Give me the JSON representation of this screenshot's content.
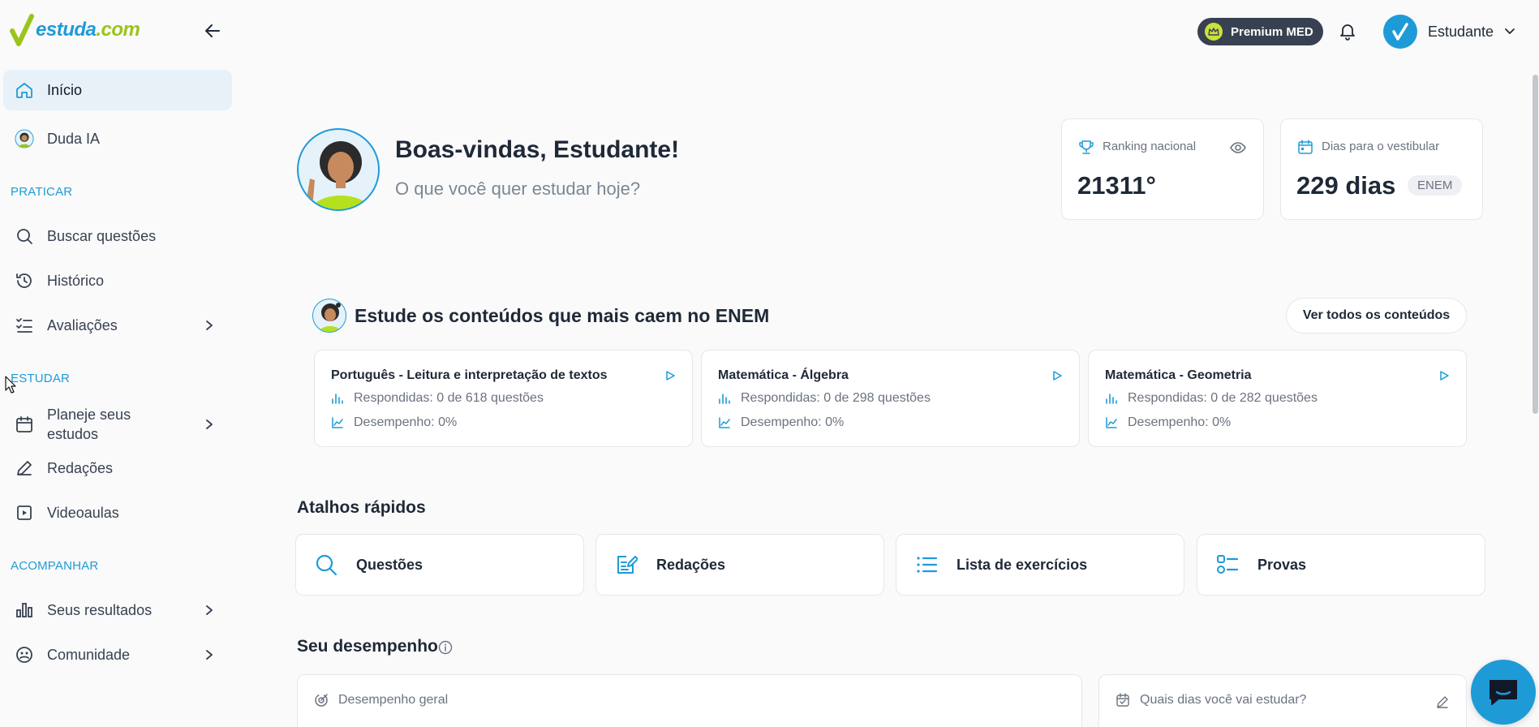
{
  "brand": {
    "name_main": "estuda",
    "name_dot": ".com"
  },
  "topbar": {
    "premium_label": "Premium MED",
    "user_name": "Estudante"
  },
  "sidebar": {
    "inicio": "Início",
    "duda": "Duda IA",
    "section_praticar": "PRATICAR",
    "buscar": "Buscar questões",
    "historico": "Histórico",
    "avaliacoes": "Avaliações",
    "section_estudar": "ESTUDAR",
    "planeje_1": "Planeje seus",
    "planeje_2": "estudos",
    "redacoes": "Redações",
    "videoaulas": "Videoaulas",
    "section_acompanhar": "ACOMPANHAR",
    "resultados": "Seus resultados",
    "comunidade": "Comunidade"
  },
  "hero": {
    "title": "Boas-vindas, Estudante!",
    "subtitle": "O que você quer estudar hoje?"
  },
  "stats": {
    "ranking_label": "Ranking nacional",
    "ranking_value": "21311°",
    "dias_label": "Dias para o vestibular",
    "dias_value": "229 dias",
    "dias_badge": "ENEM"
  },
  "contents": {
    "title": "Estude os conteúdos que mais caem no ENEM",
    "see_all": "Ver todos os conteúdos",
    "cards": [
      {
        "title": "Português - Leitura e interpretação de textos",
        "answered": "Respondidas: 0 de 618 questões",
        "performance": "Desempenho: 0%"
      },
      {
        "title": "Matemática - Álgebra",
        "answered": "Respondidas: 0 de 298 questões",
        "performance": "Desempenho: 0%"
      },
      {
        "title": "Matemática - Geometria",
        "answered": "Respondidas: 0 de 282 questões",
        "performance": "Desempenho: 0%"
      }
    ]
  },
  "shortcuts": {
    "title": "Atalhos rápidos",
    "items": [
      {
        "label": "Questões",
        "icon": "search-icon"
      },
      {
        "label": "Redações",
        "icon": "edit-note-icon"
      },
      {
        "label": "Lista de exercícios",
        "icon": "list-icon"
      },
      {
        "label": "Provas",
        "icon": "checklist-icon"
      }
    ]
  },
  "performance": {
    "title": "Seu desempenho",
    "general_label": "Desempenho geral",
    "days_label": "Quais dias você vai estudar?"
  },
  "colors": {
    "accent": "#1e9bd7",
    "brand_green": "#9bc41a",
    "premium_bg": "#374151",
    "active_bg": "#e8f1f8"
  }
}
